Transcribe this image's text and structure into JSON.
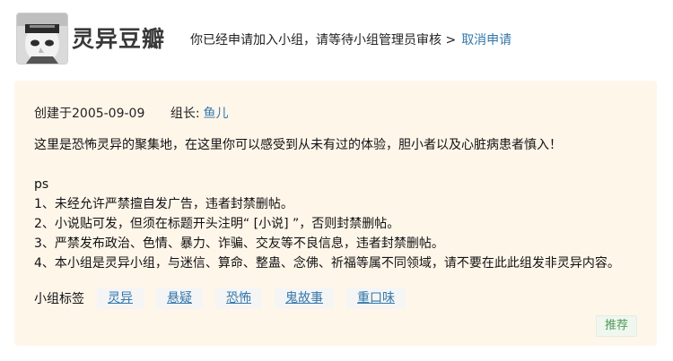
{
  "header": {
    "group_name": "灵异豆瓣",
    "status_text": "你已经申请加入小组，请等待小组管理员审核 >",
    "cancel_label": "取消申请",
    "avatar_alt": "小组头像"
  },
  "info": {
    "created_text": "创建于2005-09-09",
    "leader_label": "组长:",
    "leader_name": "鱼儿"
  },
  "description": {
    "intro": "这里是恐怖灵异的聚集地，在这里你可以感受到从未有过的体验，胆小者以及心脏病患者慎入！",
    "ps": "ps",
    "rules": [
      "1、未经允许严禁擅自发广告，违者封禁删帖。",
      "2、小说贴可发，但须在标题开头注明“ [小说] ”，否则封禁删帖。",
      "3、严禁发布政治、色情、暴力、诈骗、交友等不良信息，违者封禁删帖。",
      "4、本小组是灵异小组，与迷信、算命、整蛊、念佛、祈福等属不同领域，请不要在此此组发非灵异内容。"
    ]
  },
  "tags": {
    "label": "小组标签",
    "items": [
      "灵异",
      "悬疑",
      "恐怖",
      "鬼故事",
      "重口味"
    ]
  },
  "actions": {
    "recommend_label": "推荐"
  },
  "colors": {
    "link": "#3377aa",
    "panel_bg": "#fff6ea",
    "recommend": "#4f9a5d"
  }
}
